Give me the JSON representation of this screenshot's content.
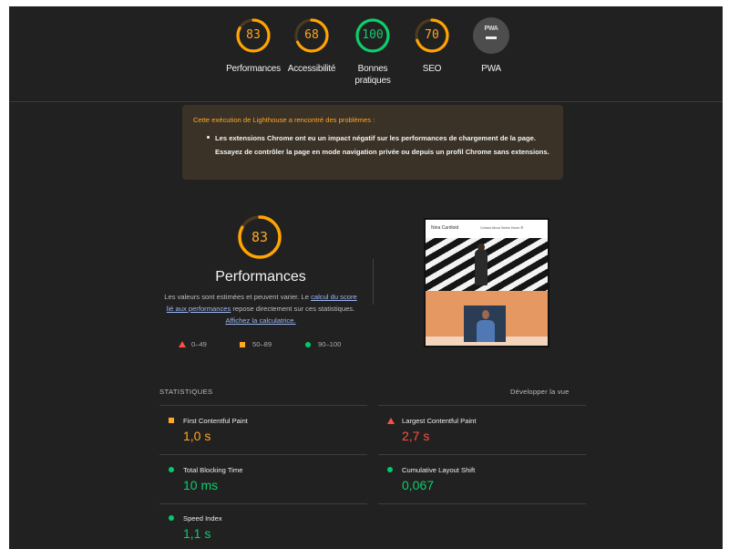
{
  "colors": {
    "pass": "#0cce6b",
    "average": "#ffa400",
    "fail": "#ff4e42",
    "background": "#212121",
    "warning_bg": "#3a3226"
  },
  "scores": [
    {
      "key": "performance",
      "label": "Performances",
      "value": "83",
      "fraction": 0.83,
      "color": "#ffa400",
      "track": "#4a3a1f"
    },
    {
      "key": "accessibility",
      "label": "Accessibilité",
      "value": "68",
      "fraction": 0.68,
      "color": "#ffa400",
      "track": "#4a3a1f"
    },
    {
      "key": "best_practices",
      "label": "Bonnes pratiques",
      "value": "100",
      "fraction": 1.0,
      "color": "#0cce6b",
      "track": "#173d28"
    },
    {
      "key": "seo",
      "label": "SEO",
      "value": "70",
      "fraction": 0.7,
      "color": "#ffa400",
      "track": "#4a3a1f"
    }
  ],
  "pwa": {
    "label": "PWA",
    "badge_text": "PWA",
    "icon": "pwa-dash-icon"
  },
  "warning": {
    "heading": "Cette exécution de Lighthouse a rencontré des problèmes :",
    "item": "Les extensions Chrome ont eu un impact négatif sur les performances de chargement de la page. Essayez de contrôler la page en mode navigation privée ou depuis un profil Chrome sans extensions."
  },
  "performance": {
    "score": "83",
    "fraction": 0.83,
    "title": "Performances",
    "desc_1": "Les valeurs sont estimées et peuvent varier. Le ",
    "link_1": "calcul du score lié aux performances",
    "desc_2": " repose directement sur ces statistiques. ",
    "link_2": "Affichez la calculatrice."
  },
  "legend": [
    {
      "icon": "triangle-icon",
      "label": "0–49"
    },
    {
      "icon": "square-icon",
      "label": "50–89"
    },
    {
      "icon": "circle-icon",
      "label": "90–100"
    }
  ],
  "thumbnail": {
    "brand": "Nina Cardioid",
    "nav": "Contact  About  Series  Home  ☰"
  },
  "statistics": {
    "heading": "STATISTIQUES",
    "expand": "Développer la vue",
    "metrics": [
      {
        "name": "First Contentful Paint",
        "value": "1,0 s",
        "status": "average",
        "icon": "square-icon",
        "color": "#ffa400"
      },
      {
        "name": "Largest Contentful Paint",
        "value": "2,7 s",
        "status": "fail",
        "icon": "triangle-icon",
        "color": "#ff4e42"
      },
      {
        "name": "Total Blocking Time",
        "value": "10 ms",
        "status": "pass",
        "icon": "circle-icon",
        "color": "#0cce6b"
      },
      {
        "name": "Cumulative Layout Shift",
        "value": "0,067",
        "status": "pass",
        "icon": "circle-icon",
        "color": "#0cce6b"
      },
      {
        "name": "Speed Index",
        "value": "1,1 s",
        "status": "pass",
        "icon": "circle-icon",
        "color": "#0cce6b"
      }
    ]
  }
}
